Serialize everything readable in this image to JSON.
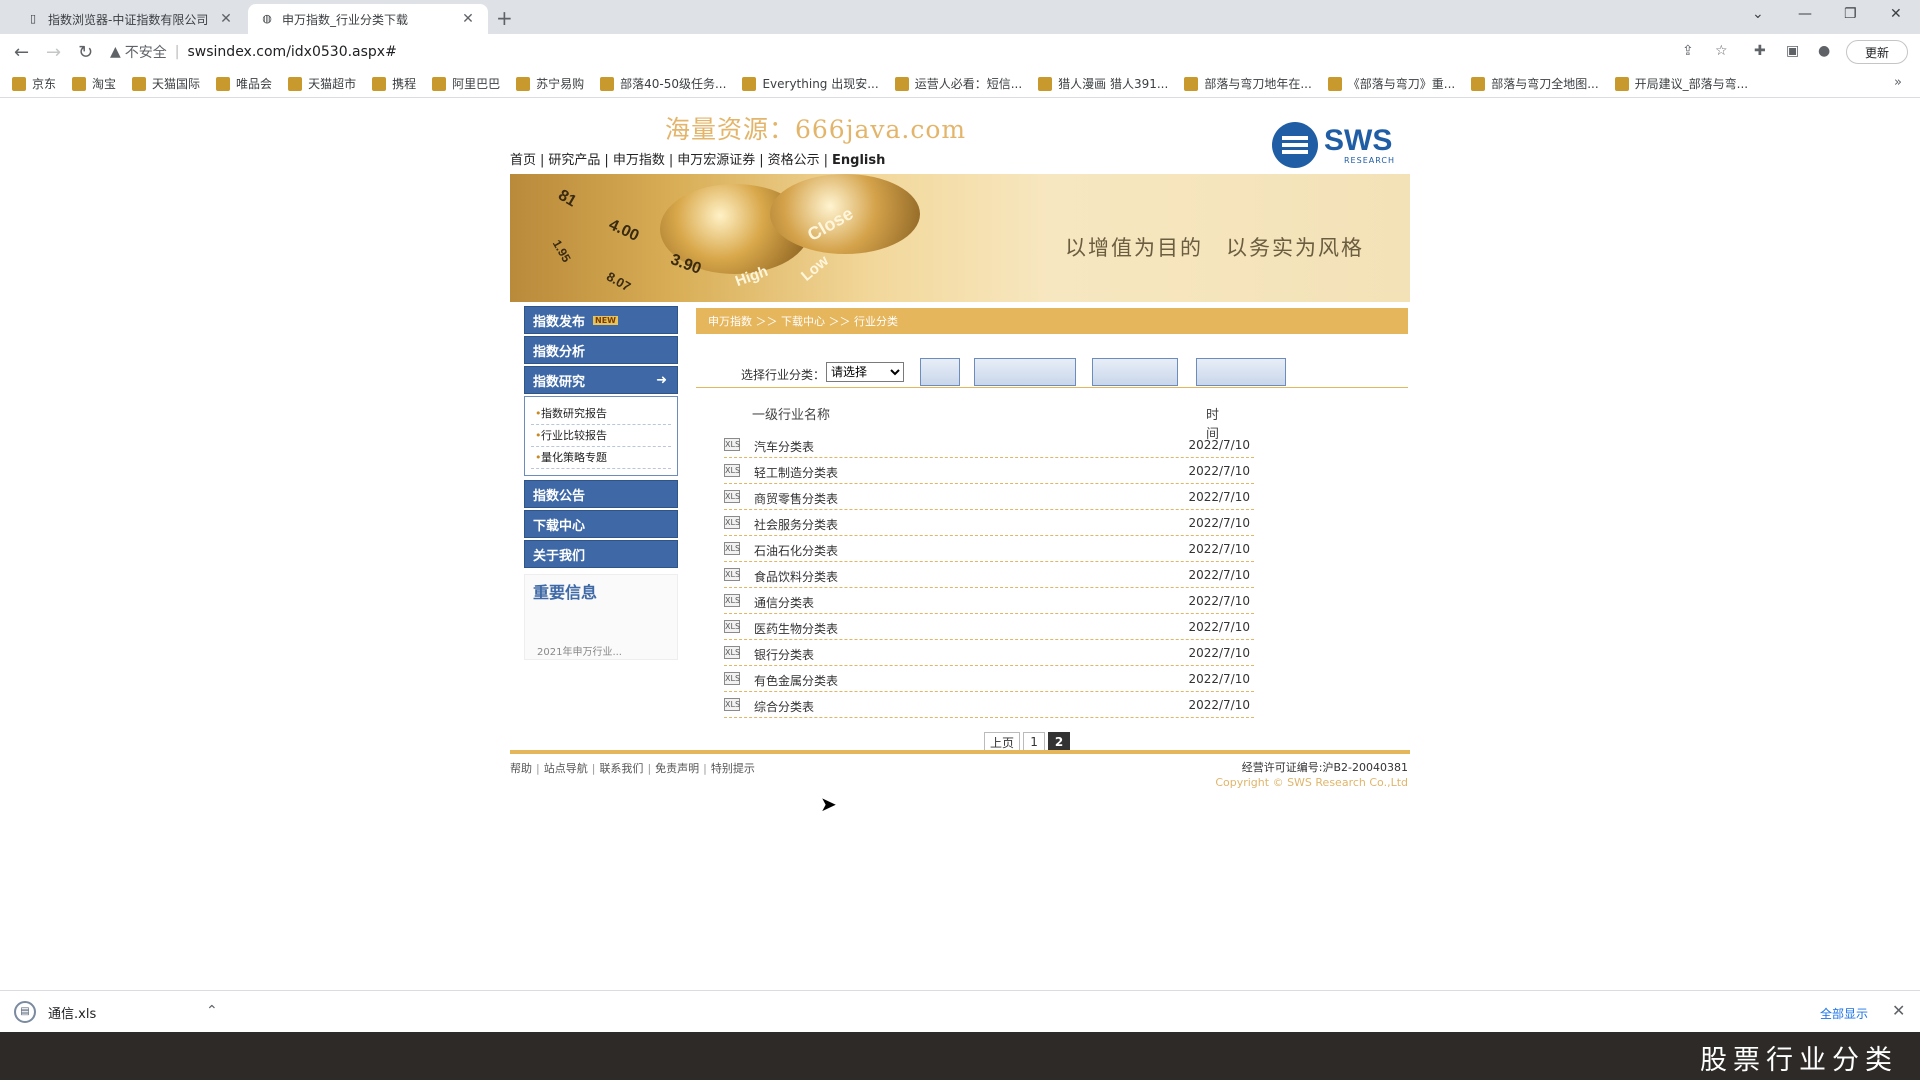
{
  "browser": {
    "tabs": [
      {
        "title": "指数浏览器-中证指数有限公司",
        "icon": "page-icon",
        "active": false
      },
      {
        "title": "申万指数_行业分类下载",
        "icon": "globe-icon",
        "active": true
      }
    ],
    "new_tab": "+",
    "address": {
      "insecure_label": "不安全",
      "url": "swsindex.com/idx0530.aspx#"
    },
    "update_button": "更新",
    "bookmarks": [
      "京东",
      "淘宝",
      "天猫国际",
      "唯品会",
      "天猫超市",
      "携程",
      "阿里巴巴",
      "苏宁易购",
      "部落40-50级任务...",
      "Everything 出现安...",
      "运营人必看：短信...",
      "猎人漫画 猎人391...",
      "部落与弯刀地年在...",
      "《部落与弯刀》重...",
      "部落与弯刀全地图...",
      "开局建议_部落与弯..."
    ]
  },
  "site": {
    "watermark": "海量资源：666java.com",
    "topnav": [
      "首页",
      "研究产品",
      "申万指数",
      "申万宏源证券",
      "资格公示",
      "English"
    ],
    "logo": {
      "text": "SWS",
      "sub": "RESEARCH"
    },
    "banner": {
      "slogan": "以增值为目的　以务实为风格",
      "tape_numbers": [
        "81",
        "4.00",
        "3.90",
        "1.95",
        "8.07"
      ],
      "tape_words": [
        "Close",
        "High",
        "Low"
      ]
    },
    "sidebar": {
      "items": [
        {
          "label": "指数发布",
          "badge": "NEW"
        },
        {
          "label": "指数分析"
        },
        {
          "label": "指数研究",
          "arrow": "➜"
        }
      ],
      "subitems": [
        "指数研究报告",
        "行业比较报告",
        "量化策略专题"
      ],
      "items2": [
        "指数公告",
        "下载中心",
        "关于我们"
      ],
      "important_title": "重要信息",
      "important_clip": "2021年申万行业..."
    },
    "main": {
      "breadcrumb": "申万指数 ＞＞ 下载中心 ＞＞ 行业分类",
      "filter_label": "选择行业分类：",
      "select_value": "请选择",
      "col_name": "一级行业名称",
      "col_time": "时间",
      "rows": [
        {
          "name": "汽车分类表",
          "date": "2022/7/10"
        },
        {
          "name": "轻工制造分类表",
          "date": "2022/7/10"
        },
        {
          "name": "商贸零售分类表",
          "date": "2022/7/10"
        },
        {
          "name": "社会服务分类表",
          "date": "2022/7/10"
        },
        {
          "name": "石油石化分类表",
          "date": "2022/7/10"
        },
        {
          "name": "食品饮料分类表",
          "date": "2022/7/10"
        },
        {
          "name": "通信分类表",
          "date": "2022/7/10"
        },
        {
          "name": "医药生物分类表",
          "date": "2022/7/10"
        },
        {
          "name": "银行分类表",
          "date": "2022/7/10"
        },
        {
          "name": "有色金属分类表",
          "date": "2022/7/10"
        },
        {
          "name": "综合分类表",
          "date": "2022/7/10"
        }
      ],
      "xls_icon": "XLS",
      "pager": {
        "prev": "上页",
        "pages": [
          "1",
          "2"
        ],
        "current": "2"
      }
    },
    "footer": {
      "links": [
        "帮助",
        "站点导航",
        "联系我们",
        "免责声明",
        "特别提示"
      ],
      "license": "经营许可证编号:沪B2-20040381",
      "copyright": "Copyright © SWS Research Co.,Ltd"
    }
  },
  "download_shelf": {
    "file": "通信.xls",
    "show_all": "全部显示",
    "close": "✕"
  },
  "caption": "股票行业分类",
  "colors": {
    "accent_gold": "#e6b65c",
    "sidebar_blue": "#3e69a6",
    "logo_blue": "#1f5da5"
  }
}
